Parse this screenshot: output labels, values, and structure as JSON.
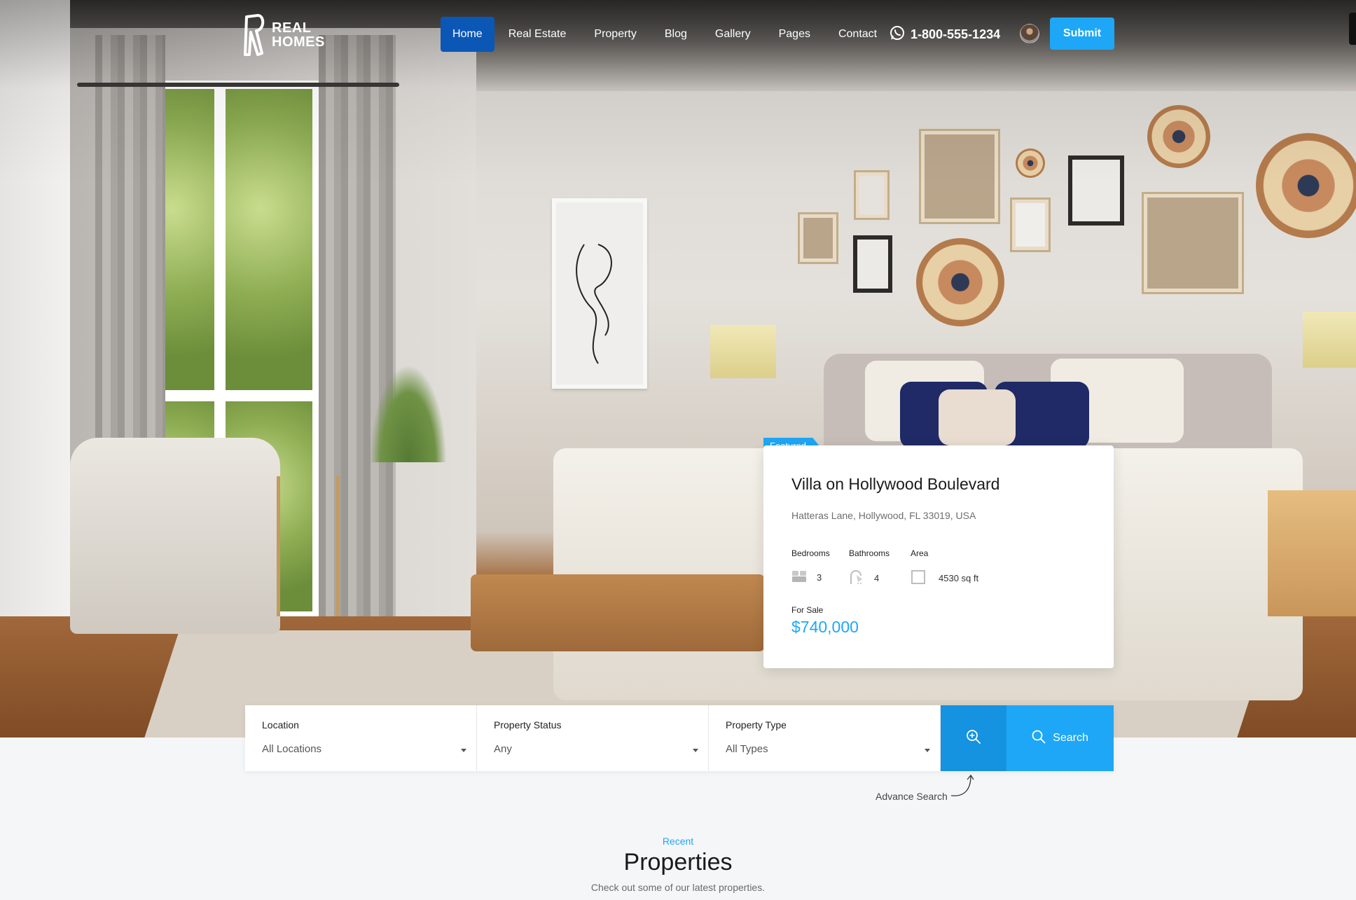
{
  "brand": {
    "logo_text_1": "REAL",
    "logo_text_2": "HOMES"
  },
  "nav": {
    "items": [
      {
        "label": "Home",
        "active": true
      },
      {
        "label": "Real Estate"
      },
      {
        "label": "Property"
      },
      {
        "label": "Blog"
      },
      {
        "label": "Gallery"
      },
      {
        "label": "Pages"
      },
      {
        "label": "Contact"
      }
    ],
    "phone": "1-800-555-1234",
    "submit_label": "Submit"
  },
  "featured": {
    "badge": "Featured",
    "title": "Villa on Hollywood Boulevard",
    "address": "Hatteras Lane, Hollywood, FL 33019, USA",
    "bedrooms_label": "Bedrooms",
    "bedrooms": "3",
    "bathrooms_label": "Bathrooms",
    "bathrooms": "4",
    "area_label": "Area",
    "area": "4530 sq ft",
    "status": "For Sale",
    "price": "$740,000"
  },
  "search": {
    "location_label": "Location",
    "location_value": "All Locations",
    "status_label": "Property Status",
    "status_value": "Any",
    "type_label": "Property Type",
    "type_value": "All Types",
    "search_label": "Search",
    "advance_label": "Advance Search"
  },
  "section": {
    "kicker": "Recent",
    "title": "Properties",
    "subtitle": "Check out some of our latest properties."
  },
  "colors": {
    "accent": "#1ea7f6",
    "nav_active": "#0b57b5",
    "advance_btn": "#1592e0"
  },
  "icons": {
    "phone": "whatsapp-icon",
    "search": "search-icon",
    "advance": "zoom-plus-icon",
    "bed": "bed-icon",
    "bath": "shower-icon",
    "area": "area-icon"
  }
}
